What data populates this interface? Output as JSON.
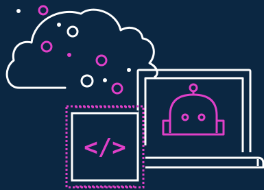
{
  "illustration": {
    "code_glyph": "</>",
    "colors": {
      "background": "#0b2742",
      "outline": "#ffffff",
      "accent": "#e040c8"
    },
    "icons": [
      "cloud-icon",
      "laptop-icon",
      "robot-icon",
      "chip-icon",
      "code-icon"
    ]
  }
}
